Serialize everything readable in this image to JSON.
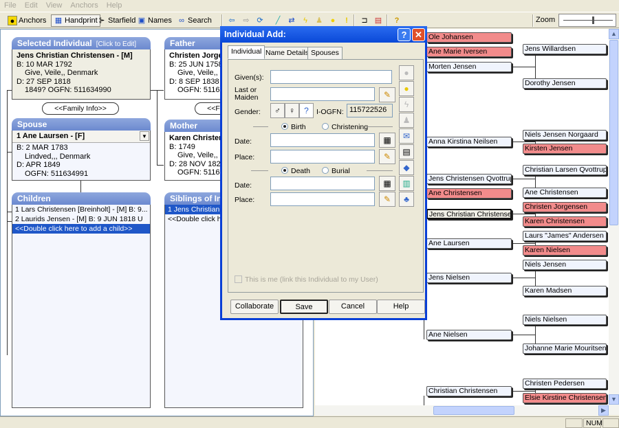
{
  "menu": [
    "File",
    "Edit",
    "View",
    "Anchors",
    "Help"
  ],
  "toolbar": {
    "anchors": "Anchors",
    "handprint": "Handprint",
    "starfield": "Starfield",
    "names": "Names",
    "search": "Search",
    "zoom": "Zoom"
  },
  "selected": {
    "header": "Selected Individual",
    "edit_hint": "[Click to Edit]",
    "name": "Jens Christian Christensen - [M]",
    "lines": [
      "B: 10 MAR 1792",
      "Give, Veile,, Denmark",
      "D: 27 SEP 1818",
      "1849?    OGFN: 511634990"
    ]
  },
  "family_info": "<<Family Info>>",
  "father": {
    "header": "Father",
    "name": "Christen Jorgensen",
    "lines": [
      "B: 25 JUN 1758",
      "Give, Veile,, Denmark",
      "D: 8 SEP 1838",
      "OGFN: 511681"
    ]
  },
  "spouse": {
    "header": "Spouse",
    "selected": "1 Ane Laursen - [F]",
    "lines": [
      "B: 2 MAR 1783",
      "Lindved,,, Denmark",
      "D: APR 1849",
      "OGFN: 511634991"
    ]
  },
  "mother": {
    "header": "Mother",
    "name": "Karen Christensen",
    "lines": [
      "B: 1749",
      "Give, Veile,, Denmark",
      "D: 28 NOV 1821",
      "OGFN: 511635"
    ]
  },
  "children": {
    "header": "Children",
    "rows": [
      "1 Lars Christensen [Breinholt] - [M]          B: 9...",
      "2 Laurids Jensen - [M]      B: 9 JUN 1818        U"
    ],
    "add": "<<Double click here to add a child>>"
  },
  "siblings": {
    "header": "Siblings of Individual",
    "rows": [
      "1 Jens Christian Christensen"
    ],
    "add": "<<Double click here to add a sibling>>"
  },
  "tree": {
    "col1": [
      {
        "name": "Ole Johansen",
        "red": true
      },
      {
        "name": "Ane Marie Iversen",
        "red": true
      },
      {
        "name": "Morten Jensen"
      },
      {
        "name": "Anna Kirstina Neilsen"
      },
      {
        "name": "Jens Christensen Qvottrup"
      },
      {
        "name": "Ane Christensen",
        "red": true
      },
      {
        "name": "Jens Christian Christensen",
        "current": true
      },
      {
        "name": "Ane Laursen"
      },
      {
        "name": "Jens Nielsen"
      },
      {
        "name": "Ane Nielsen"
      },
      {
        "name": "Christian Christensen"
      }
    ],
    "col2": [
      {
        "name": "Jens Willardsen"
      },
      {
        "name": "Dorothy Jensen"
      },
      {
        "name": "Niels Jensen Norgaard"
      },
      {
        "name": "Kirsten Jensen",
        "red": true
      },
      {
        "name": "Christian Larsen Qvottrup"
      },
      {
        "name": "Ane Christensen"
      },
      {
        "name": "Christen Jorgensen",
        "red": true
      },
      {
        "name": "Karen Christensen",
        "red": true
      },
      {
        "name": "Laurs \"James\" Andersen"
      },
      {
        "name": "Karen Nielsen",
        "red": true
      },
      {
        "name": "Niels Jensen"
      },
      {
        "name": "Karen Madsen"
      },
      {
        "name": "Niels Nielsen"
      },
      {
        "name": "Johanne Marie Mouritsen"
      },
      {
        "name": "Christen Pedersen"
      },
      {
        "name": "Elsie Kirstine Christensen",
        "red": true
      }
    ]
  },
  "status": {
    "num": "NUM"
  },
  "dialog": {
    "title": "Individual Add:",
    "tabs": [
      "Individual",
      "Name Details",
      "Spouses"
    ],
    "given_label": "Given(s):",
    "given_value": "",
    "last_label": "Last or\nMaiden",
    "last_value": "",
    "gender_label": "Gender:",
    "iogfn_label": "I-OGFN:",
    "iogfn_value": "115722526",
    "birth": "Birth",
    "christening": "Christening",
    "death": "Death",
    "burial": "Burial",
    "date_label": "Date:",
    "place_label": "Place:",
    "this_is_me": "This is me (link this Individual to my User)",
    "buttons": {
      "collaborate": "Collaborate",
      "save": "Save",
      "cancel": "Cancel",
      "help": "Help"
    }
  },
  "colors": {
    "female_node": "#f28b8b",
    "header_blue": "#7b96d6",
    "selection": "#1f57c8",
    "dialog_title": "#0a49d8"
  }
}
